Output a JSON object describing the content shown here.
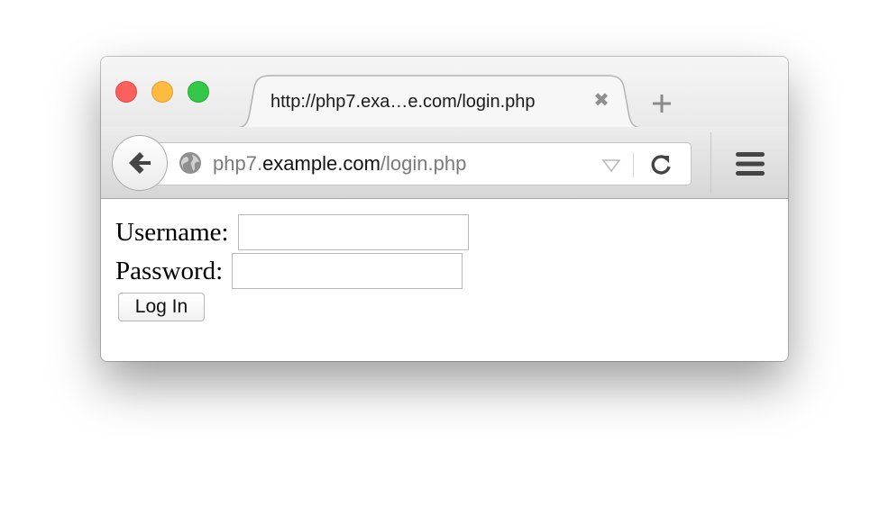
{
  "browser": {
    "tab": {
      "title": "http://php7.exa…e.com/login.php",
      "close_glyph": "✖"
    },
    "new_tab_icon": "plus-icon",
    "url": {
      "prefix": "php7.",
      "host": "example.com",
      "path": "/login.php"
    },
    "icons": [
      "back-arrow-icon",
      "globe-icon",
      "dropdown-arrow-icon",
      "reload-icon",
      "hamburger-menu-icon"
    ],
    "colors": {
      "close": "#fc605c",
      "minimize": "#fdbc40",
      "maximize": "#34c84a"
    }
  },
  "form": {
    "username_label": "Username:",
    "username_value": "",
    "password_label": "Password:",
    "password_value": "",
    "submit_label": "Log In"
  }
}
